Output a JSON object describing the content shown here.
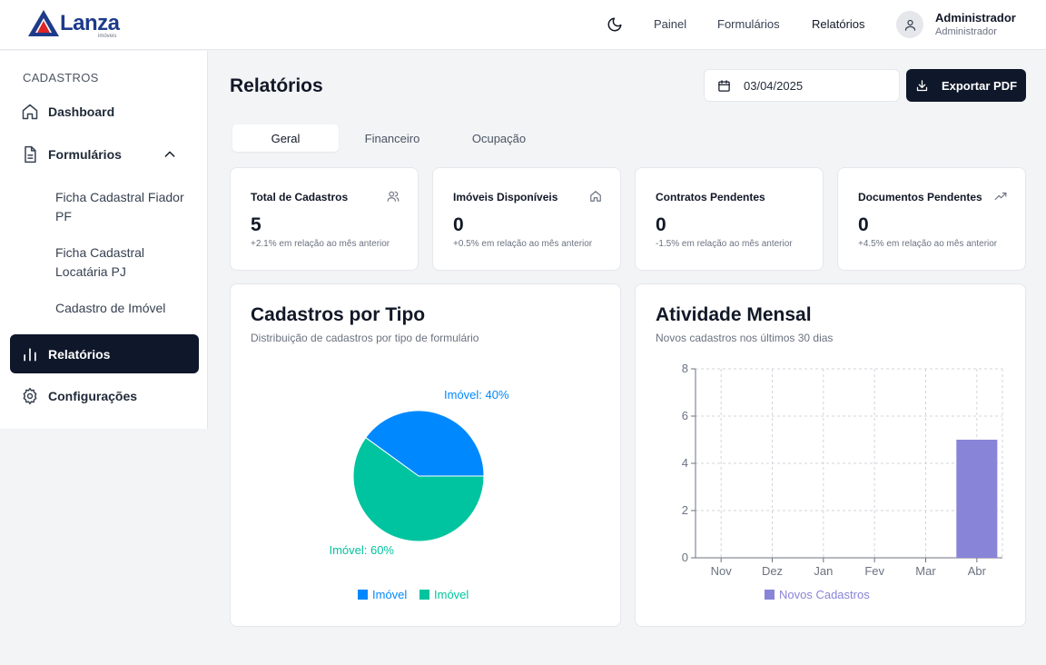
{
  "brand": {
    "name": "Lanza",
    "tagline": "imóveis",
    "color_dark": "#1e3a8a",
    "color_red": "#dc2626"
  },
  "header": {
    "nav": [
      {
        "label": "Painel"
      },
      {
        "label": "Formulários"
      },
      {
        "label": "Relatórios"
      }
    ],
    "user": {
      "name": "Administrador",
      "role": "Administrador"
    },
    "theme_icon": "moon-icon"
  },
  "sidebar": {
    "section_label": "CADASTROS",
    "items": [
      {
        "label": "Dashboard",
        "icon": "home-icon"
      },
      {
        "label": "Formulários",
        "icon": "document-icon",
        "expanded": true
      },
      {
        "label": "Relatórios",
        "icon": "bar-chart-icon",
        "active": true
      },
      {
        "label": "Configurações",
        "icon": "gear-icon"
      }
    ],
    "subitems": [
      {
        "label": "Ficha Cadastral Fiador PF"
      },
      {
        "label": "Ficha Cadastral Locatária PJ"
      },
      {
        "label": "Cadastro de Imóvel"
      }
    ]
  },
  "page": {
    "title": "Relatórios",
    "date_value": "03/04/2025",
    "export_label": "Exportar PDF",
    "tabs": [
      {
        "label": "Geral",
        "active": true
      },
      {
        "label": "Financeiro"
      },
      {
        "label": "Ocupação"
      }
    ]
  },
  "stats": [
    {
      "title": "Total de Cadastros",
      "value": "5",
      "note": "+2.1% em relação ao mês anterior",
      "icon": "users-icon"
    },
    {
      "title": "Imóveis Disponíveis",
      "value": "0",
      "note": "+0.5% em relação ao mês anterior",
      "icon": "house-icon"
    },
    {
      "title": "Contratos Pendentes",
      "value": "0",
      "note": "-1.5% em relação ao mês anterior",
      "icon": ""
    },
    {
      "title": "Documentos Pendentes",
      "value": "0",
      "note": "+4.5% em relação ao mês anterior",
      "icon": "trending-up-icon"
    }
  ],
  "panels": {
    "pie": {
      "title": "Cadastros por Tipo",
      "subtitle": "Distribuição de cadastros por tipo de formulário"
    },
    "bar": {
      "title": "Atividade Mensal",
      "subtitle": "Novos cadastros nos últimos 30 dias"
    }
  },
  "chart_data": [
    {
      "type": "pie",
      "title": "Cadastros por Tipo",
      "slices": [
        {
          "label": "Imóvel",
          "value": 40,
          "data_label": "Imóvel: 40%",
          "color": "#0088fe"
        },
        {
          "label": "Imóvel",
          "value": 60,
          "data_label": "Imóvel: 60%",
          "color": "#00c49f"
        }
      ],
      "legend": [
        "Imóvel",
        "Imóvel"
      ],
      "legend_position": "bottom"
    },
    {
      "type": "bar",
      "title": "Atividade Mensal",
      "categories": [
        "Nov",
        "Dez",
        "Jan",
        "Fev",
        "Mar",
        "Abr"
      ],
      "series": [
        {
          "name": "Novos Cadastros",
          "values": [
            0,
            0,
            0,
            0,
            0,
            5
          ],
          "color": "#8884d8"
        }
      ],
      "ylim": [
        0,
        8
      ],
      "yticks": [
        0,
        2,
        4,
        6,
        8
      ],
      "grid": true,
      "legend_position": "bottom"
    }
  ]
}
